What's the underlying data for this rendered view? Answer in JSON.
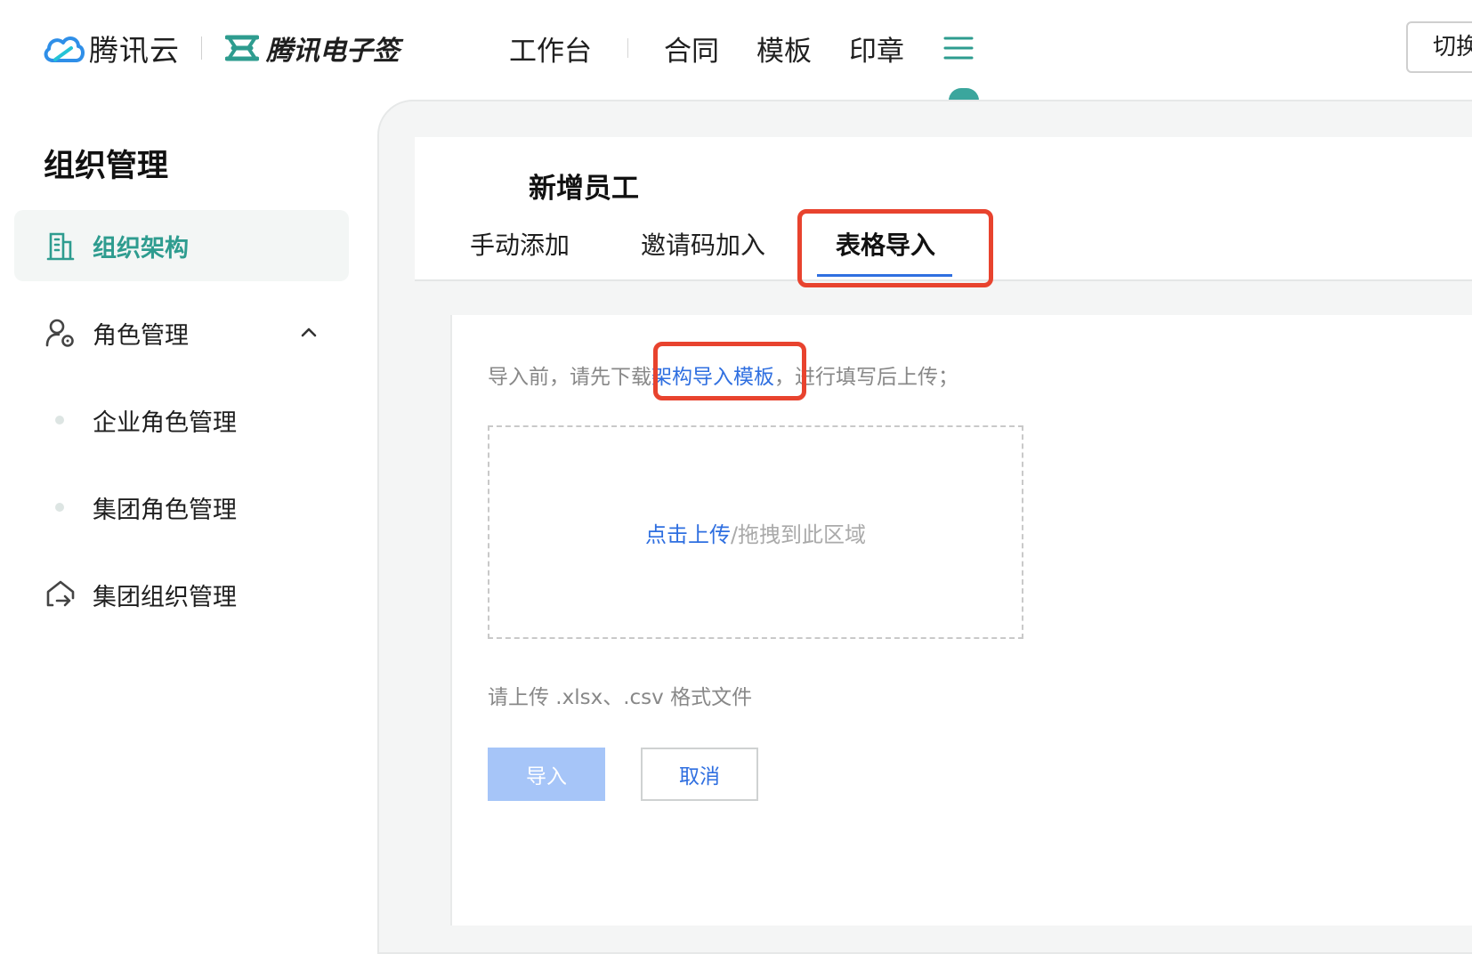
{
  "brand": {
    "cloud_name": "腾讯云",
    "esign_name": "腾讯电子签"
  },
  "nav": {
    "workbench": "工作台",
    "contract": "合同",
    "template": "模板",
    "seal": "印章",
    "switch_label": "切换"
  },
  "sidebar": {
    "title": "组织管理",
    "items": [
      {
        "label": "组织架构",
        "icon": "building-icon",
        "active": true
      },
      {
        "label": "角色管理",
        "icon": "user-role-icon",
        "expanded": true
      },
      {
        "label": "企业角色管理"
      },
      {
        "label": "集团角色管理"
      },
      {
        "label": "集团组织管理",
        "icon": "group-org-icon"
      }
    ]
  },
  "card": {
    "title": "新增员工",
    "tabs": [
      {
        "label": "手动添加"
      },
      {
        "label": "邀请码加入"
      },
      {
        "label": "表格导入",
        "active": true
      }
    ]
  },
  "import": {
    "hint_prefix": "导入前，请先下载",
    "hint_link": "架构导入模板",
    "hint_suffix": "，进行填写后上传；",
    "upload_link": "点击上传",
    "upload_suffix": "/拖拽到此区域",
    "format_note": "请上传 .xlsx、.csv 格式文件",
    "import_label": "导入",
    "cancel_label": "取消"
  },
  "colors": {
    "accent_teal": "#2e9c8f",
    "link_blue": "#2f6fe0",
    "highlight_red": "#e8432e",
    "disabled_button": "#a6c5f8"
  }
}
